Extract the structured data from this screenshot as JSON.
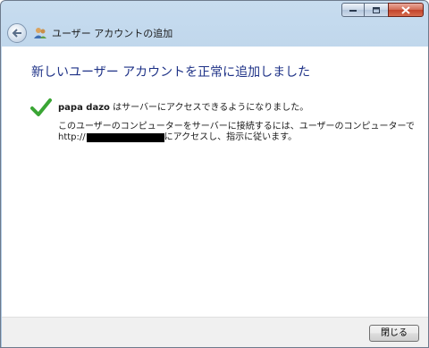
{
  "window": {
    "minimize_label": "minimize",
    "maximize_label": "maximize",
    "close_label": "close"
  },
  "nav": {
    "back_icon": "back-arrow-icon",
    "app_icon": "users-icon",
    "title": "ユーザー アカウントの追加"
  },
  "content": {
    "heading": "新しいユーザー アカウントを正常に追加しました",
    "status_icon": "checkmark-icon",
    "username": "papa dazo",
    "status_text": " はサーバーにアクセスできるようになりました。",
    "info_text": "このユーザーのコンピューターをサーバーに接続するには、ユーザーのコンピューターで",
    "url_prefix": "http://",
    "url_suffix": "にアクセスし、指示に従います。"
  },
  "footer": {
    "close_button": "閉じる"
  },
  "colors": {
    "heading": "#1e3287",
    "check": "#3aa534",
    "titlebar": "#b3cde6"
  }
}
